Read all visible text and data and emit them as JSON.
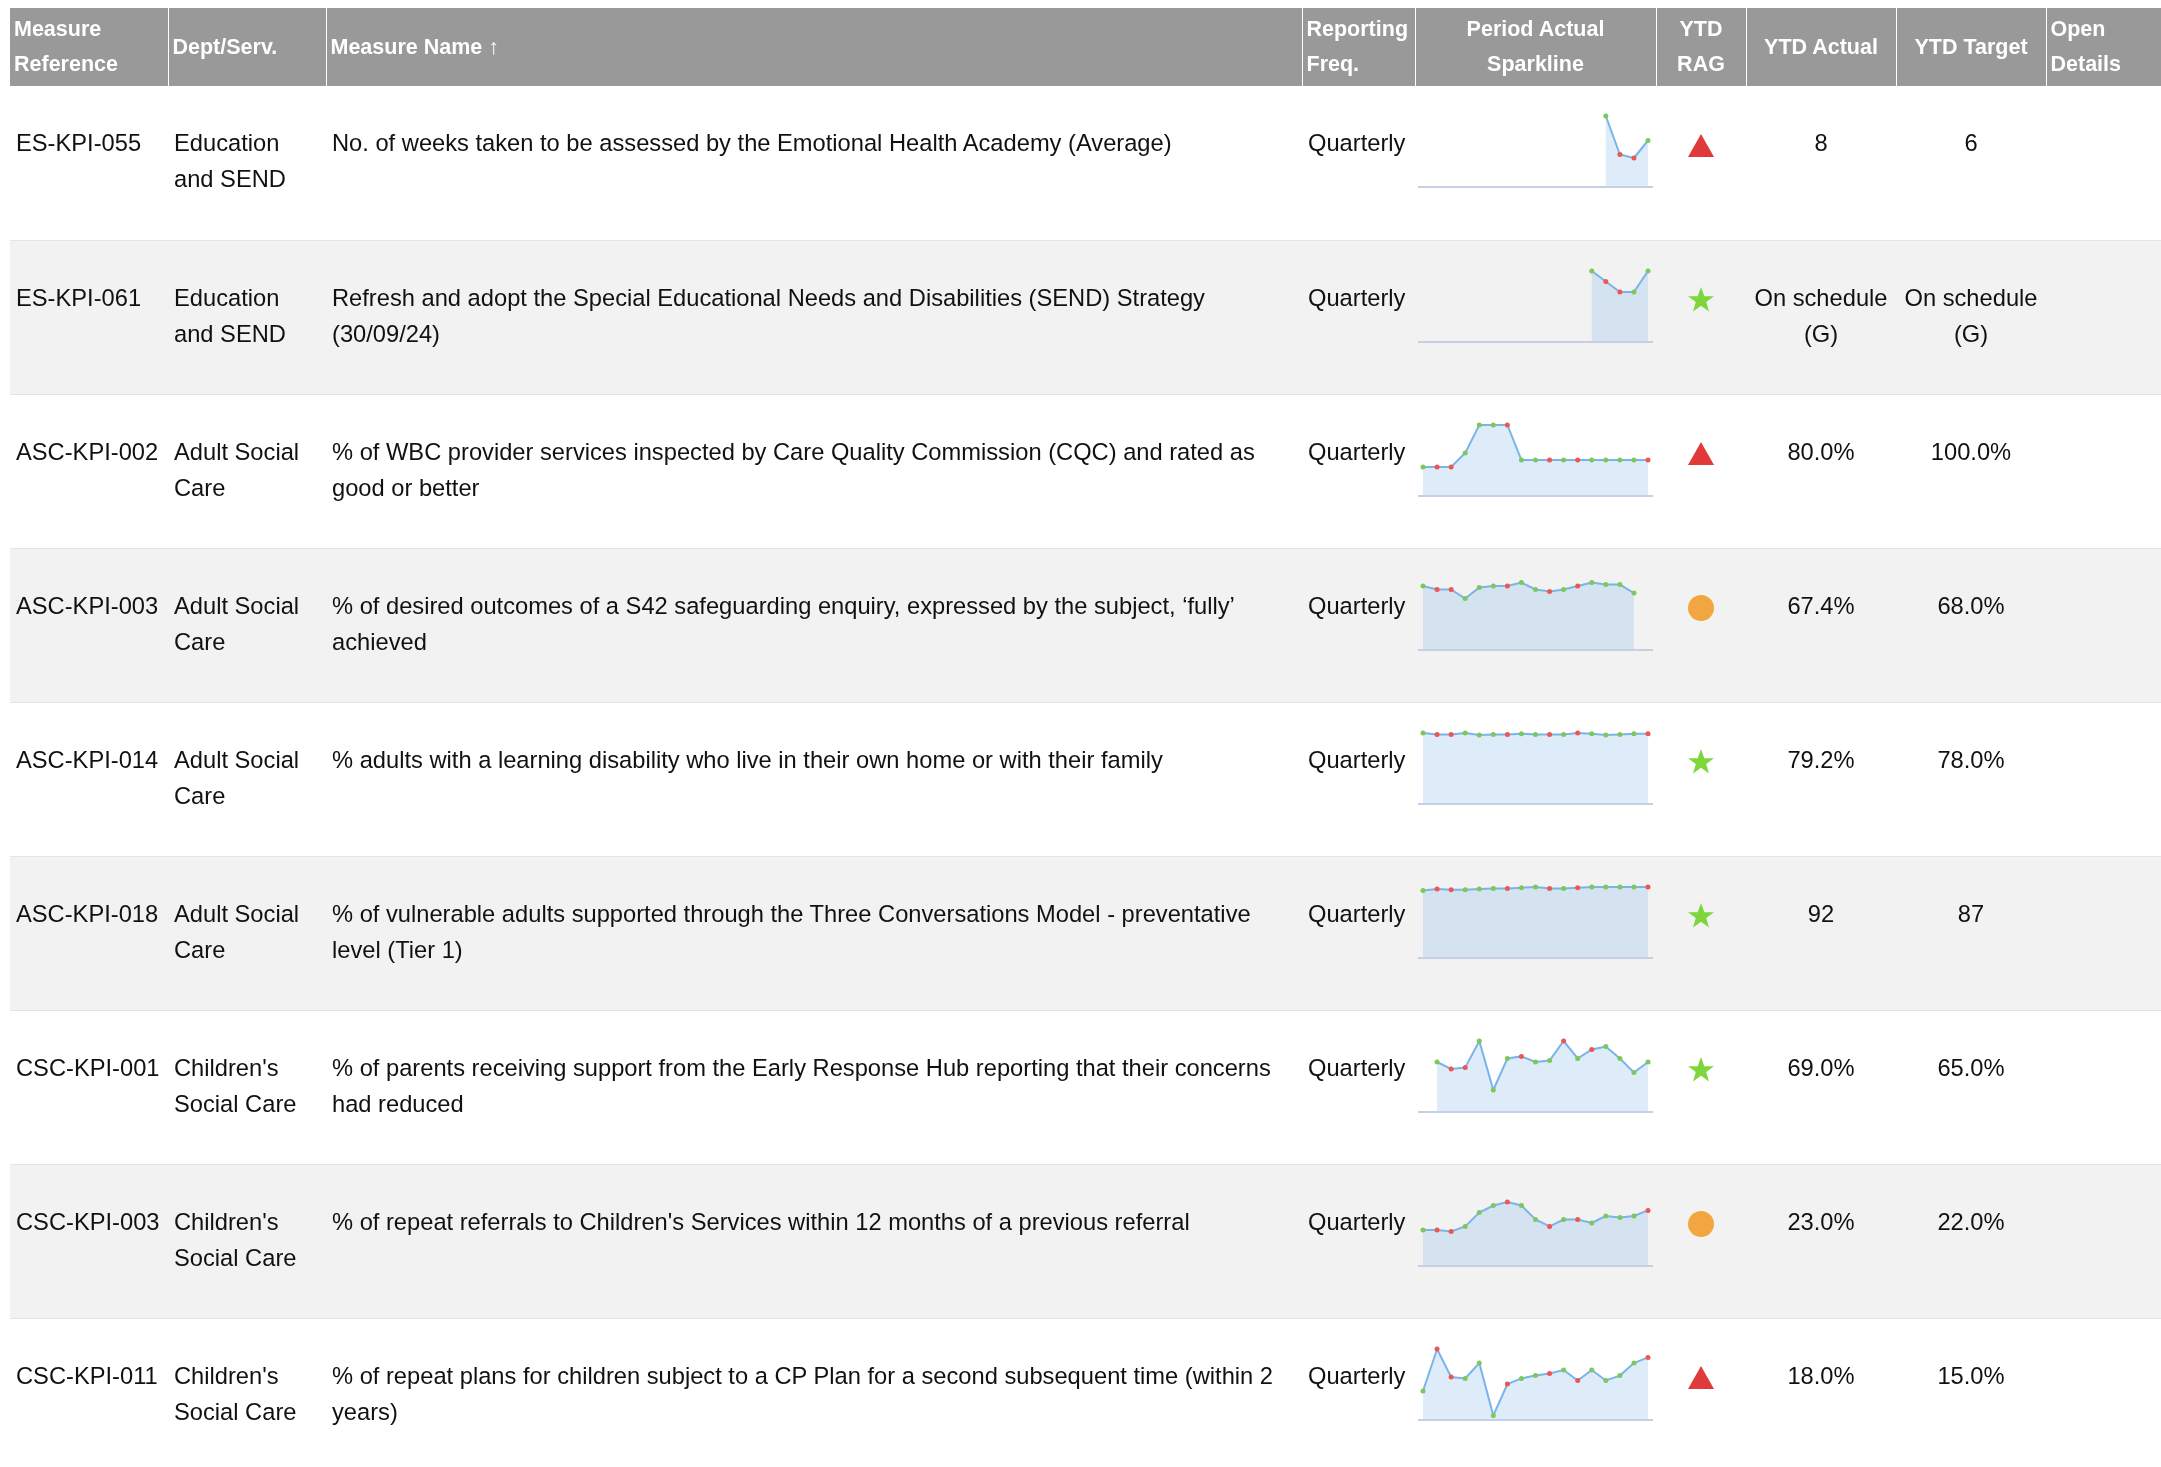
{
  "table": {
    "columns": [
      {
        "label": "Measure Reference"
      },
      {
        "label": "Dept/Serv."
      },
      {
        "label": "Measure Name ↑"
      },
      {
        "label": "Reporting Freq."
      },
      {
        "label": "Period Actual Sparkline"
      },
      {
        "label": "YTD RAG"
      },
      {
        "label": "YTD Actual"
      },
      {
        "label": "YTD Target"
      },
      {
        "label": "Open Details"
      }
    ],
    "rows": [
      {
        "ref": "ES-KPI-055",
        "dept": "Education and SEND",
        "name": "No. of weeks taken to be assessed by the Emotional Health Academy (Average)",
        "freq": "Quarterly",
        "rag": {
          "kind": "triangle",
          "color": "#e03a3a"
        },
        "ytd_actual": "8",
        "ytd_target": "6"
      },
      {
        "ref": "ES-KPI-061",
        "dept": "Education and SEND",
        "name": "Refresh and adopt the Special Educational Needs and Disabilities (SEND) Strategy (30/09/24)",
        "freq": "Quarterly",
        "rag": {
          "kind": "star",
          "color": "#7ed63a"
        },
        "ytd_actual": "On schedule (G)",
        "ytd_target": "On schedule (G)"
      },
      {
        "ref": "ASC-KPI-002",
        "dept": "Adult Social Care",
        "name": "% of WBC provider services inspected by Care Quality Commission (CQC) and rated as good or better",
        "freq": "Quarterly",
        "rag": {
          "kind": "triangle",
          "color": "#e03a3a"
        },
        "ytd_actual": "80.0%",
        "ytd_target": "100.0%"
      },
      {
        "ref": "ASC-KPI-003",
        "dept": "Adult Social Care",
        "name": "% of desired outcomes of a S42 safeguarding enquiry, expressed by the subject, ‘fully’ achieved",
        "freq": "Quarterly",
        "rag": {
          "kind": "circle",
          "color": "#f2a641"
        },
        "ytd_actual": "67.4%",
        "ytd_target": "68.0%"
      },
      {
        "ref": "ASC-KPI-014",
        "dept": "Adult Social Care",
        "name": "% adults with a learning disability who live in their own home or with their family",
        "freq": "Quarterly",
        "rag": {
          "kind": "star",
          "color": "#7ed63a"
        },
        "ytd_actual": "79.2%",
        "ytd_target": "78.0%"
      },
      {
        "ref": "ASC-KPI-018",
        "dept": "Adult Social Care",
        "name": "% of vulnerable adults supported through the Three Conversations Model - preventative level (Tier 1)",
        "freq": "Quarterly",
        "rag": {
          "kind": "star",
          "color": "#7ed63a"
        },
        "ytd_actual": "92",
        "ytd_target": "87"
      },
      {
        "ref": "CSC-KPI-001",
        "dept": "Children's Social Care",
        "name": "% of parents receiving support from the Early Response Hub reporting that their concerns had reduced",
        "freq": "Quarterly",
        "rag": {
          "kind": "star",
          "color": "#7ed63a"
        },
        "ytd_actual": "69.0%",
        "ytd_target": "65.0%"
      },
      {
        "ref": "CSC-KPI-003",
        "dept": "Children's Social Care",
        "name": "% of repeat referrals to Children's Services within 12 months of a previous referral",
        "freq": "Quarterly",
        "rag": {
          "kind": "circle",
          "color": "#f2a641"
        },
        "ytd_actual": "23.0%",
        "ytd_target": "22.0%"
      },
      {
        "ref": "CSC-KPI-011",
        "dept": "Children's Social Care",
        "name": "% of repeat plans for children subject to a CP Plan for a second subsequent time (within 2 years)",
        "freq": "Quarterly",
        "rag": {
          "kind": "triangle",
          "color": "#e03a3a"
        },
        "ytd_actual": "18.0%",
        "ytd_target": "15.0%"
      }
    ]
  }
}
